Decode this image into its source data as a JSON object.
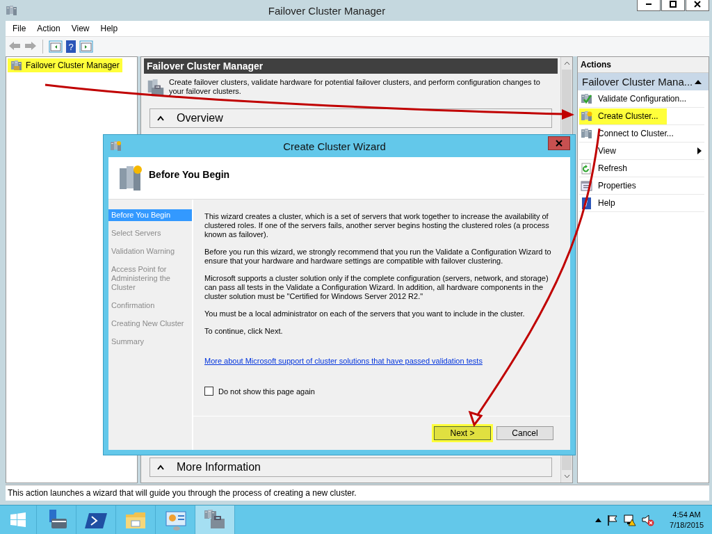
{
  "window": {
    "title": "Failover Cluster Manager"
  },
  "menu": [
    "File",
    "Action",
    "View",
    "Help"
  ],
  "toolbar": [
    {
      "kind": "back",
      "disabled": true
    },
    {
      "kind": "forward",
      "disabled": true
    },
    {
      "kind": "tree-toggle"
    },
    {
      "kind": "help",
      "glyph": "?"
    },
    {
      "kind": "pane-toggle"
    }
  ],
  "tree": {
    "items": [
      {
        "label": "Failover Cluster Manager",
        "highlighted": true
      }
    ]
  },
  "center": {
    "title": "Failover Cluster Manager",
    "description": "Create failover clusters, validate hardware for potential failover clusters, and perform configuration changes to your failover clusters.",
    "sections": [
      {
        "title": "Overview",
        "expanded": true
      },
      {
        "title": "More Information",
        "expanded": true
      }
    ]
  },
  "actions": {
    "title": "Actions",
    "group": {
      "title": "Failover Cluster Mana...",
      "expanded": true
    },
    "items": [
      {
        "label": "Validate Configuration...",
        "kind": "validate",
        "highlighted": false
      },
      {
        "label": "Create Cluster...",
        "kind": "create",
        "highlighted": true
      },
      {
        "label": "Connect to Cluster...",
        "kind": "connect",
        "highlighted": false
      },
      {
        "label": "View",
        "kind": "submenu",
        "highlighted": false
      },
      {
        "label": "Refresh",
        "kind": "refresh",
        "highlighted": false
      },
      {
        "label": "Properties",
        "kind": "properties",
        "highlighted": false
      },
      {
        "label": "Help",
        "kind": "help",
        "highlighted": false
      }
    ]
  },
  "wizard": {
    "title": "Create Cluster Wizard",
    "page_title": "Before You Begin",
    "steps": [
      {
        "label": "Before You Begin",
        "selected": true
      },
      {
        "label": "Select Servers",
        "selected": false
      },
      {
        "label": "Validation Warning",
        "selected": false
      },
      {
        "label": "Access Point for Administering the Cluster",
        "selected": false
      },
      {
        "label": "Confirmation",
        "selected": false
      },
      {
        "label": "Creating New Cluster",
        "selected": false
      },
      {
        "label": "Summary",
        "selected": false
      }
    ],
    "paragraphs": [
      "This wizard creates a cluster, which is a set of servers that work together to increase the availability of clustered roles. If one of the servers fails, another server begins hosting the clustered roles (a process known as failover).",
      "Before you run this wizard, we strongly recommend that you run the Validate a Configuration Wizard to ensure that your hardware and hardware settings are compatible with failover clustering.",
      "Microsoft supports a cluster solution only if the complete configuration (servers, network, and storage) can pass all tests in the Validate a Configuration Wizard. In addition, all hardware components in the cluster solution must be \"Certified for Windows Server 2012 R2.\"",
      "You must be a local administrator on each of the servers that you want to include in the cluster.",
      "To continue, click Next."
    ],
    "link": "More about Microsoft support of cluster solutions that have passed validation tests",
    "checkbox": {
      "label": "Do not show this page again",
      "checked": false
    },
    "buttons": [
      {
        "label": "Next >",
        "kind": "next",
        "highlighted": true
      },
      {
        "label": "Cancel",
        "kind": "cancel",
        "highlighted": false
      }
    ]
  },
  "status_bar": "This action launches a wizard that will guide you through the process of creating a new cluster.",
  "taskbar": {
    "apps": [
      {
        "kind": "server-manager",
        "selected": false
      },
      {
        "kind": "powershell",
        "selected": false
      },
      {
        "kind": "explorer",
        "selected": false
      },
      {
        "kind": "control-panel",
        "selected": false
      },
      {
        "kind": "cluster-manager",
        "selected": true
      }
    ],
    "clock": {
      "time": "4:54 AM",
      "date": "7/18/2015"
    }
  }
}
